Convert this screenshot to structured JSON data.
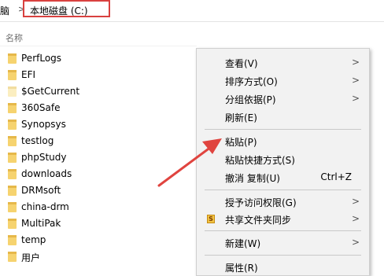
{
  "address_bar": {
    "prev_crumb": "脑",
    "separator": ">",
    "current_crumb": "本地磁盘 (C:)"
  },
  "file_list": {
    "column_header": "名称",
    "items": [
      {
        "name": "PerfLogs",
        "icon": "folder-icon"
      },
      {
        "name": "EFI",
        "icon": "folder-icon"
      },
      {
        "name": "$GetCurrent",
        "icon": "folder-icon"
      },
      {
        "name": "360Safe",
        "icon": "folder-icon"
      },
      {
        "name": "Synopsys",
        "icon": "folder-icon"
      },
      {
        "name": "testlog",
        "icon": "folder-icon"
      },
      {
        "name": "phpStudy",
        "icon": "folder-icon"
      },
      {
        "name": "downloads",
        "icon": "folder-icon"
      },
      {
        "name": "DRMsoft",
        "icon": "folder-icon"
      },
      {
        "name": "china-drm",
        "icon": "folder-icon"
      },
      {
        "name": "MultiPak",
        "icon": "folder-icon"
      },
      {
        "name": "temp",
        "icon": "folder-icon"
      },
      {
        "name": "用户",
        "icon": "folder-icon"
      }
    ]
  },
  "context_menu": {
    "items": [
      {
        "label": "查看(V)",
        "submenu": ">"
      },
      {
        "label": "排序方式(O)",
        "submenu": ">"
      },
      {
        "label": "分组依据(P)",
        "submenu": ">"
      },
      {
        "label": "刷新(E)"
      },
      {
        "label": "粘贴(P)"
      },
      {
        "label": "粘贴快捷方式(S)"
      },
      {
        "label": "撤消 复制(U)",
        "shortcut": "Ctrl+Z"
      },
      {
        "label": "授予访问权限(G)",
        "submenu": ">"
      },
      {
        "label": "共享文件夹同步",
        "submenu": ">",
        "icon": "share-sync-icon",
        "icon_glyph": "S"
      },
      {
        "label": "新建(W)",
        "submenu": ">"
      },
      {
        "label": "属性(R)"
      }
    ]
  },
  "annotation": {
    "highlight_color": "#d9413f"
  }
}
